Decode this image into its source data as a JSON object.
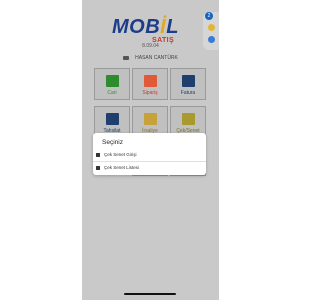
{
  "app": {
    "brand_main": "MOB",
    "brand_highlight": "İ",
    "brand_end": "L",
    "brand_sub": "SATIŞ",
    "version": "8.09.04",
    "user_name": "HASAN CANTÜRK"
  },
  "tiles": [
    {
      "label": "Cari",
      "color": "#2e8b2e",
      "icon": "contacts-card-icon"
    },
    {
      "label": "Sipariş",
      "color": "#e05a3a",
      "icon": "order-grid-icon"
    },
    {
      "label": "Fatura",
      "color": "#1f3f6e",
      "icon": "invoice-list-icon"
    },
    {
      "label": "Tahsilat",
      "color": "#1f3f6e",
      "icon": "collection-list-icon"
    },
    {
      "label": "İrsaliye",
      "color": "#c7a13a",
      "icon": "waybill-list-icon"
    },
    {
      "label": "Çek/Senet",
      "color": "#a89a2c",
      "icon": "cheque-list-icon"
    }
  ],
  "dialog": {
    "title": "Seçiniz",
    "items": [
      {
        "label": "Çek Senet Girişi",
        "icon": "entry-icon"
      },
      {
        "label": "Çek Senet Listesi",
        "icon": "list-icon"
      }
    ]
  },
  "side_widget": {
    "badge": "2"
  }
}
